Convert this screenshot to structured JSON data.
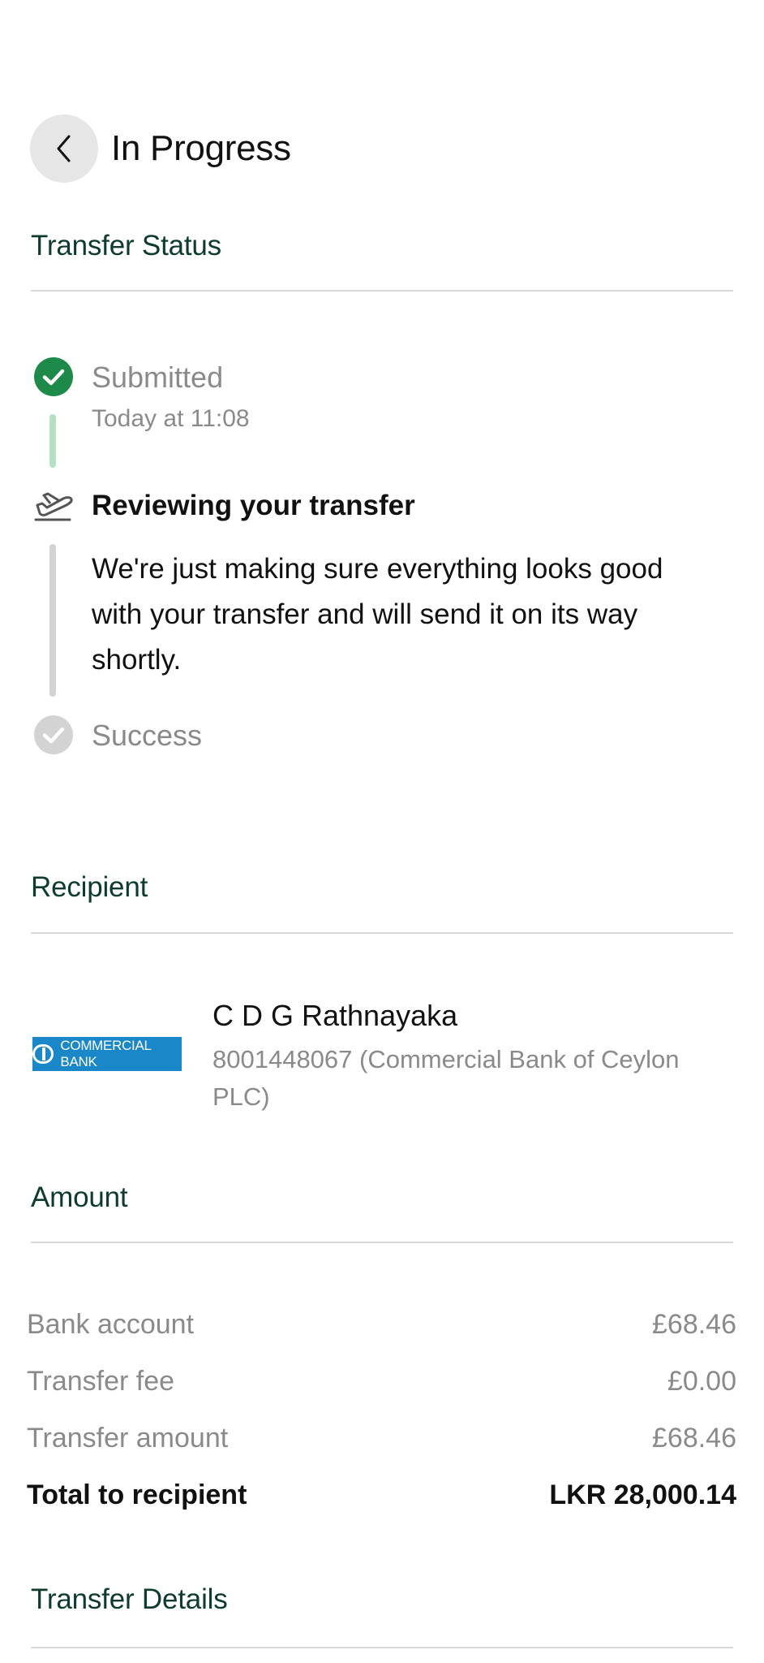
{
  "header": {
    "title": "In Progress"
  },
  "transfer_status": {
    "section_title": "Transfer Status",
    "steps": [
      {
        "label": "Submitted",
        "time": "Today at 11:08",
        "state": "done"
      },
      {
        "label": "Reviewing your transfer",
        "description": "We're just making sure everything looks good with your transfer and will send it on its way shortly.",
        "state": "active"
      },
      {
        "label": "Success",
        "state": "pending"
      }
    ]
  },
  "recipient": {
    "section_title": "Recipient",
    "bank_logo_text": "COMMERCIAL BANK",
    "name": "C D G Rathnayaka",
    "account": "8001448067 (Commercial Bank of Ceylon PLC)"
  },
  "amount": {
    "section_title": "Amount",
    "rows": [
      {
        "label": "Bank account",
        "value": "£68.46"
      },
      {
        "label": "Transfer fee",
        "value": "£0.00"
      },
      {
        "label": "Transfer amount",
        "value": "£68.46"
      }
    ],
    "total": {
      "label": "Total to recipient",
      "value": "LKR 28,000.14"
    }
  },
  "transfer_details": {
    "section_title": "Transfer Details"
  },
  "colors": {
    "section_title": "#0e3b2f",
    "success_green": "#1e8a4a",
    "progress_green": "#b4e2c0",
    "muted": "#8a8a8a",
    "bank_blue": "#1a87c9"
  },
  "icons": [
    "chevron-left-icon",
    "check-circle-icon",
    "plane-takeoff-icon",
    "check-circle-pending-icon"
  ]
}
